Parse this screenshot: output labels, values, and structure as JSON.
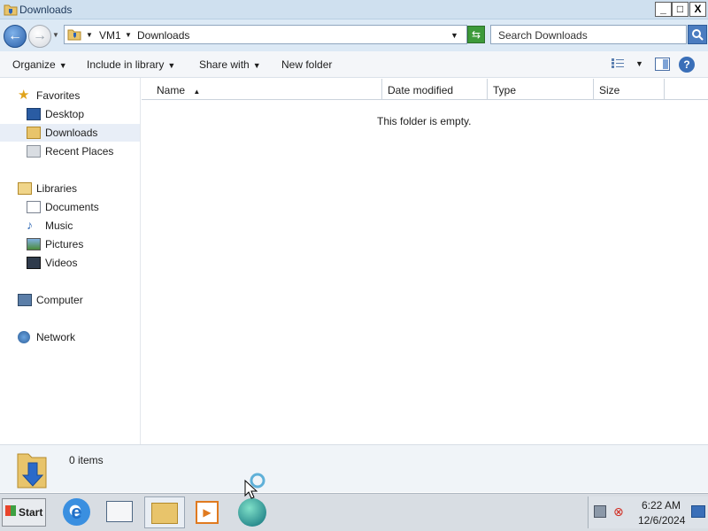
{
  "window": {
    "title": "Downloads"
  },
  "titlebar_buttons": {
    "minimize": "_",
    "maximize": "□",
    "close": "X"
  },
  "address": {
    "computer": "VM1",
    "folder": "Downloads"
  },
  "search": {
    "placeholder": "Search Downloads"
  },
  "toolbar": {
    "organize": "Organize",
    "include_in_library": "Include in library",
    "share_with": "Share with",
    "new_folder": "New folder"
  },
  "nav": {
    "favorites": "Favorites",
    "favorites_items": [
      "Desktop",
      "Downloads",
      "Recent Places"
    ],
    "libraries": "Libraries",
    "libraries_items": [
      "Documents",
      "Music",
      "Pictures",
      "Videos"
    ],
    "computer": "Computer",
    "network": "Network"
  },
  "columns": [
    "Name",
    "Date modified",
    "Type",
    "Size"
  ],
  "empty_message": "This folder is empty.",
  "details": {
    "items": "0 items"
  },
  "taskbar": {
    "start": "Start",
    "time": "6:22 AM",
    "date": "12/6/2024"
  }
}
